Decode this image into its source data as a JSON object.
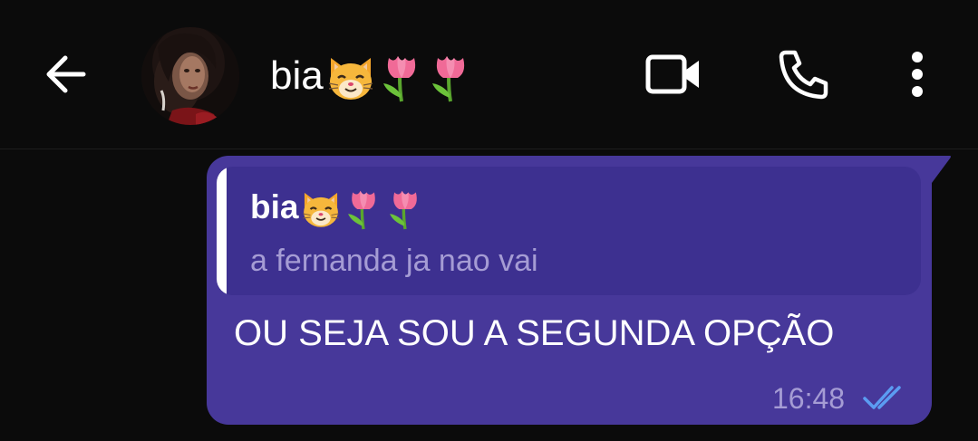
{
  "header": {
    "contact_name": "bia",
    "name_emojis": [
      "cat-face-icon",
      "tulip-icon",
      "tulip-icon"
    ],
    "icons": {
      "back": "back-arrow-icon",
      "video": "video-camera-icon",
      "call": "phone-icon",
      "more": "more-vertical-icon"
    }
  },
  "message": {
    "quoted": {
      "author": "bia",
      "author_emojis": [
        "cat-face-icon",
        "tulip-icon",
        "tulip-icon"
      ],
      "text": "a fernanda ja nao vai"
    },
    "text": "OU SEJA SOU A SEGUNDA OPÇÃO",
    "time": "16:48",
    "status_icon": "double-check-read-icon"
  },
  "colors": {
    "background": "#0b0b0b",
    "bubble": "#47389a",
    "quote_background": "#3d3090",
    "secondary_text": "#a59cd4",
    "read_ticks": "#5b9cf2"
  }
}
